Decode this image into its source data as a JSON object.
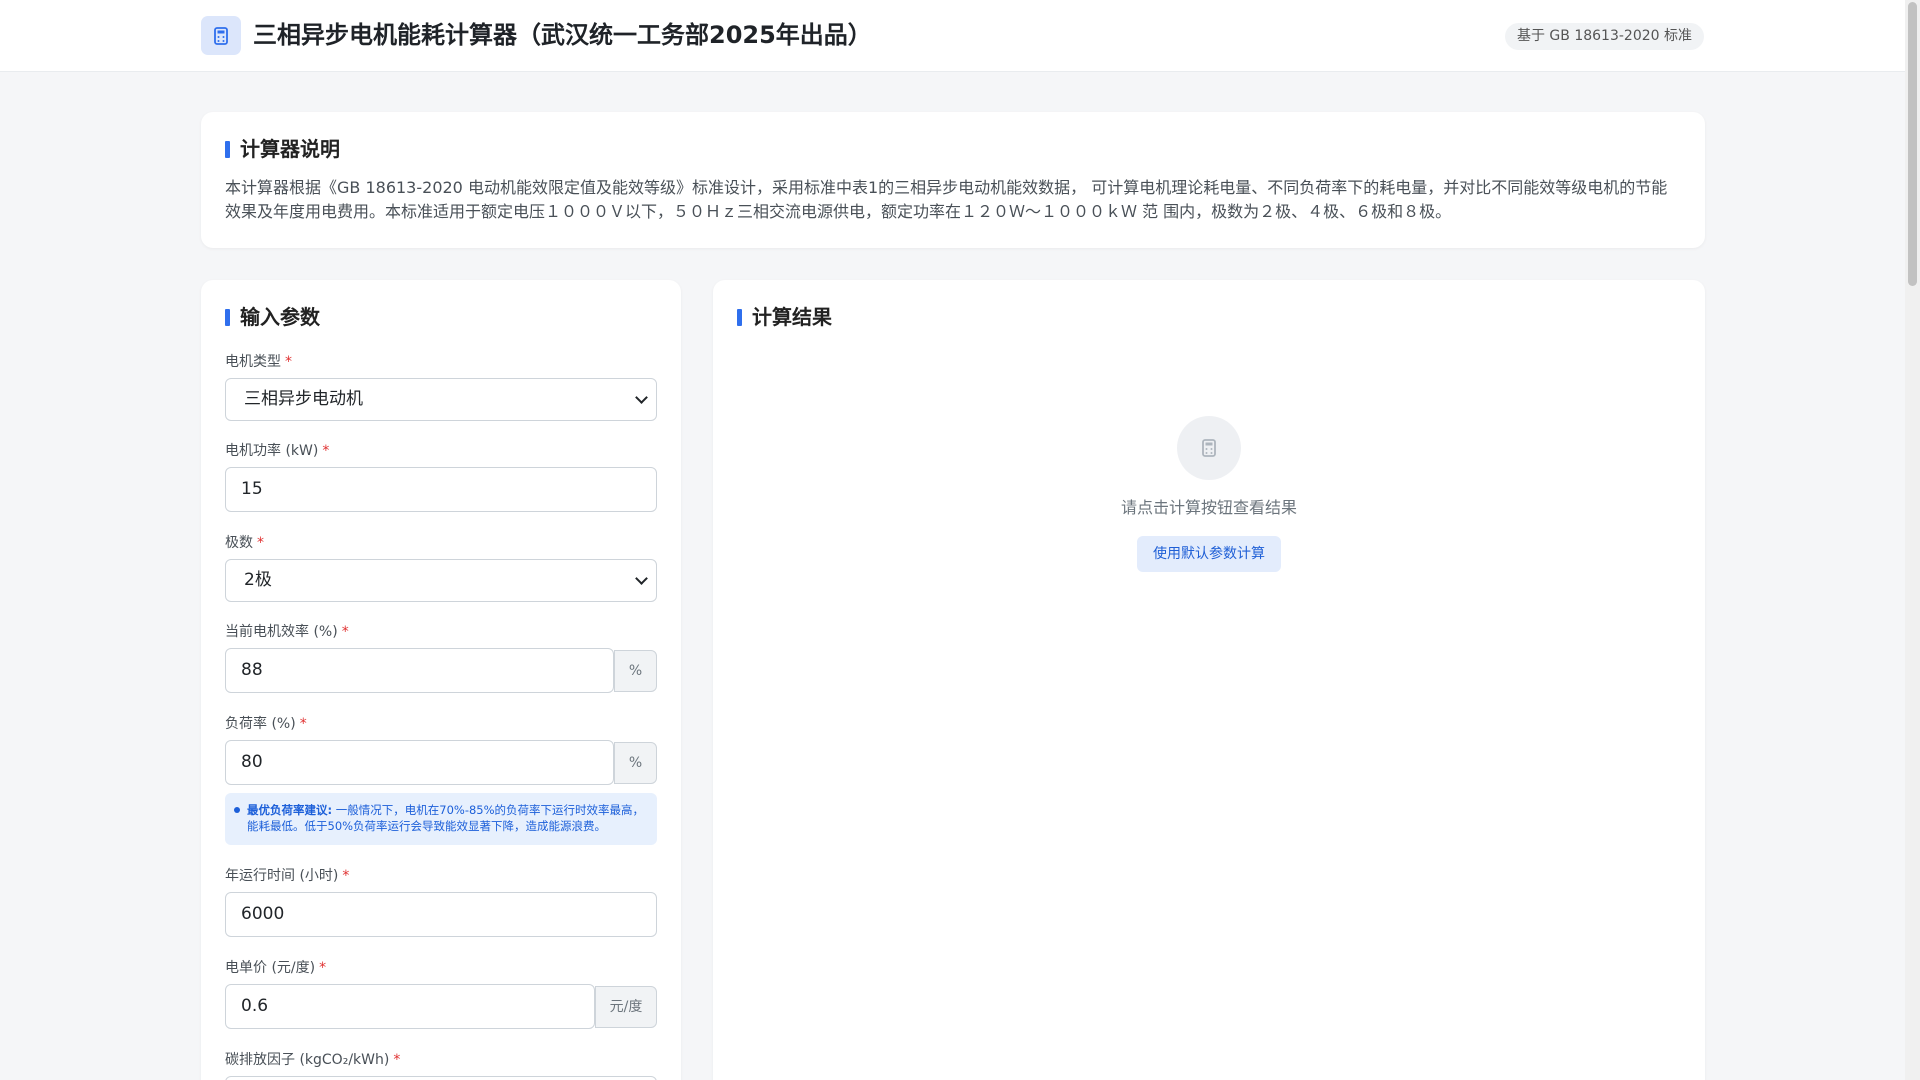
{
  "header": {
    "logo_icon": "calculator-icon",
    "title": "三相异步电机能耗计算器（武汉统一工务部2025年出品）",
    "standard_badge": "基于 GB 18613-2020 标准"
  },
  "description": {
    "icon": "info-icon",
    "title": "计算器说明",
    "text": "本计算器根据《GB 18613-2020 电动机能效限定值及能效等级》标准设计，采用标准中表1的三相异步电动机能效数据， 可计算电机理论耗电量、不同负荷率下的耗电量，并对比不同能效等级电机的节能效果及年度用电费用。本标准适用于额定电压１０００Ｖ以下，５０Ｈｚ三相交流电源供电，额定功率在１２０Ｗ～１０００ｋＷ 范 围内，极数为２极、４极、６极和８极。"
  },
  "input_panel": {
    "icon": "edit-icon",
    "title": "输入参数",
    "required_mark": "*",
    "motor_type": {
      "label": "电机类型",
      "value": "三相异步电动机"
    },
    "power": {
      "label": "电机功率 (kW)",
      "value": "15"
    },
    "poles": {
      "label": "极数",
      "value": "2极"
    },
    "efficiency": {
      "label": "当前电机效率 (%)",
      "value": "88",
      "unit": "%"
    },
    "load_rate": {
      "label": "负荷率 (%)",
      "value": "80",
      "unit": "%"
    },
    "tip": {
      "icon": "lightbulb-icon",
      "strong": "最优负荷率建议:",
      "text": " 一般情况下，电机在70%-85%的负荷率下运行时效率最高，能耗最低。低于50%负荷率运行会导致能效显著下降，造成能源浪费。"
    },
    "annual_hours": {
      "label": "年运行时间 (小时)",
      "value": "6000"
    },
    "price": {
      "label": "电单价 (元/度)",
      "value": "0.6",
      "unit": "元/度"
    },
    "carbon_factor": {
      "label": "碳排放因子 (kgCO₂/kWh)"
    }
  },
  "result_panel": {
    "icon": "chart-icon",
    "title": "计算结果",
    "empty_icon": "calculator-icon",
    "empty_text": "请点击计算按钮查看结果",
    "default_button": "使用默认参数计算"
  },
  "colors": {
    "accent": "#2f6fed",
    "required": "#e03131",
    "tip_bg": "#e7f0fd"
  }
}
